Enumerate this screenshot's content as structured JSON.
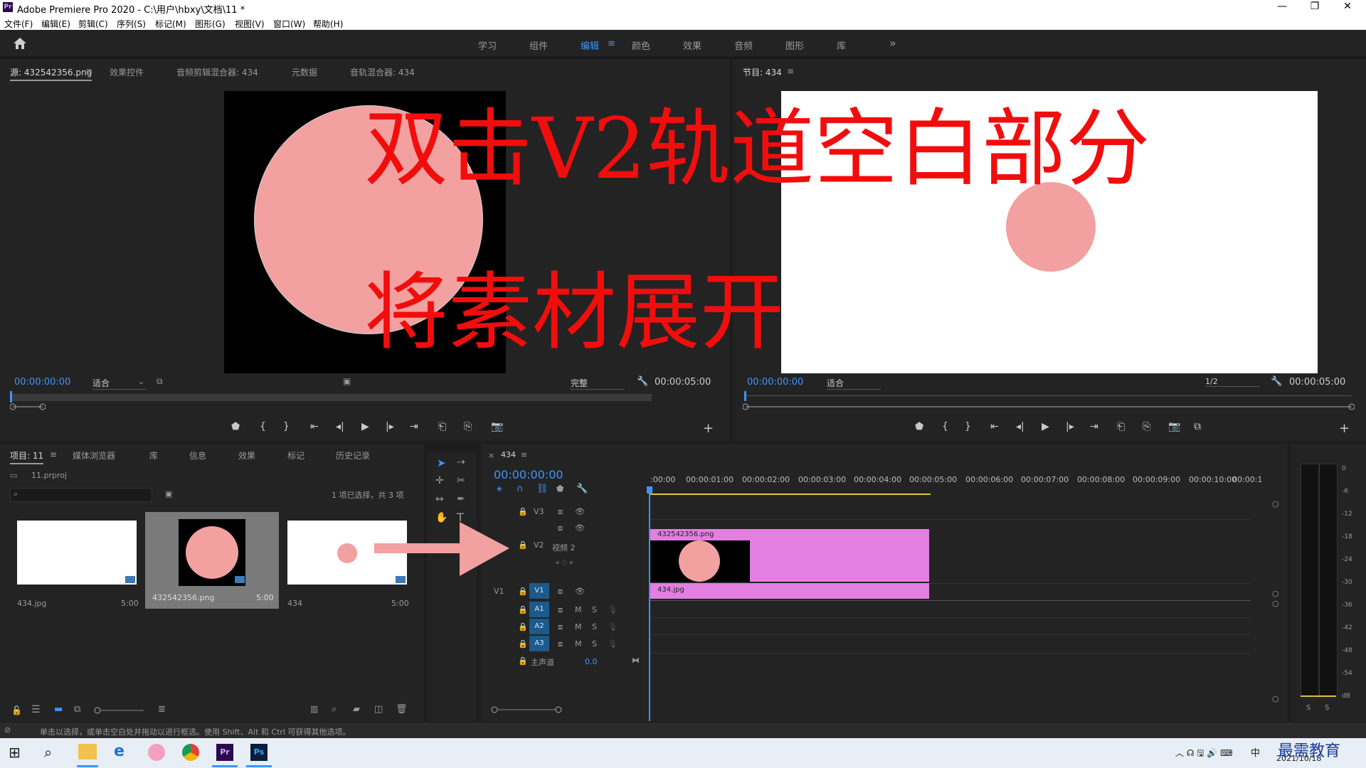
{
  "window": {
    "title": "Adobe Premiere Pro 2020 - C:\\用户\\hbxy\\文档\\11 *",
    "logo": "Pr",
    "minimize": "—",
    "restore": "❐",
    "close": "✕"
  },
  "menu": [
    "文件(F)",
    "编辑(E)",
    "剪辑(C)",
    "序列(S)",
    "标记(M)",
    "图形(G)",
    "视图(V)",
    "窗口(W)",
    "帮助(H)"
  ],
  "workspaces": [
    "学习",
    "组件",
    "编辑",
    "颜色",
    "效果",
    "音频",
    "图形",
    "库"
  ],
  "workspace_active": "编辑",
  "workspace_more": "»",
  "source_tabs": [
    "源: 432542356.png",
    "效果控件",
    "音频剪辑混合器: 434",
    "元数据",
    "音轨混合器: 434"
  ],
  "source": {
    "timecode": "00:00:00:00",
    "fit": "适合",
    "quality": "完整",
    "duration": "00:00:05:00"
  },
  "program": {
    "title": "节目: 434",
    "timecode": "00:00:00:00",
    "fit": "适合",
    "quality": "1/2",
    "duration": "00:00:05:00"
  },
  "overlay": {
    "line1": "双击V2轨道空白部分",
    "line2": "将素材展开"
  },
  "project_tabs": [
    "项目: 11",
    "媒体浏览器",
    "库",
    "信息",
    "效果",
    "标记",
    "历史记录"
  ],
  "project": {
    "file": "11.prproj",
    "search_placeholder": "",
    "selection_info": "1 项已选择，共 3 项",
    "items": [
      {
        "name": "434.jpg",
        "duration": "5:00"
      },
      {
        "name": "432542356.png",
        "duration": "5:00"
      },
      {
        "name": "434",
        "duration": "5:00"
      }
    ]
  },
  "timeline": {
    "sequence": "434",
    "timecode": "00:00:00:00",
    "ruler": [
      ":00:00",
      "00:00:01:00",
      "00:00:02:00",
      "00:00:03:00",
      "00:00:04:00",
      "00:00:05:00",
      "00:00:06:00",
      "00:00:07:00",
      "00:00:08:00",
      "00:00:09:00",
      "00:00:10:00",
      "00:00:1"
    ],
    "tracks": {
      "v3": "V3",
      "v2": "V2",
      "v2_name": "视频 2",
      "v1_src": "V1",
      "v1": "V1",
      "a1": "A1",
      "a2": "A2",
      "a3": "A3",
      "m": "M",
      "s": "S",
      "master": "主声道",
      "master_value": "0.0"
    },
    "clips": {
      "v2": "432542356.png",
      "v1": "434.jpg"
    }
  },
  "meter": {
    "ticks": [
      "0",
      "-6",
      "-12",
      "-18",
      "-24",
      "-30",
      "-36",
      "-42",
      "-48",
      "-54",
      "dB"
    ],
    "solo_left": "S",
    "solo_right": "S"
  },
  "status": "单击以选择，或单击空白处并拖动以进行框选。使用 Shift、Alt 和 Ctrl 可获得其他选项。",
  "tray": {
    "ime": "中",
    "date": "2021/10/18",
    "watermark": "最需教育"
  },
  "colors": {
    "accent": "#3d95ff",
    "clip": "#e37fe0",
    "pink": "#f2a0a0",
    "overlay": "#f20d0d",
    "track_btn": "#1c5a8c"
  }
}
